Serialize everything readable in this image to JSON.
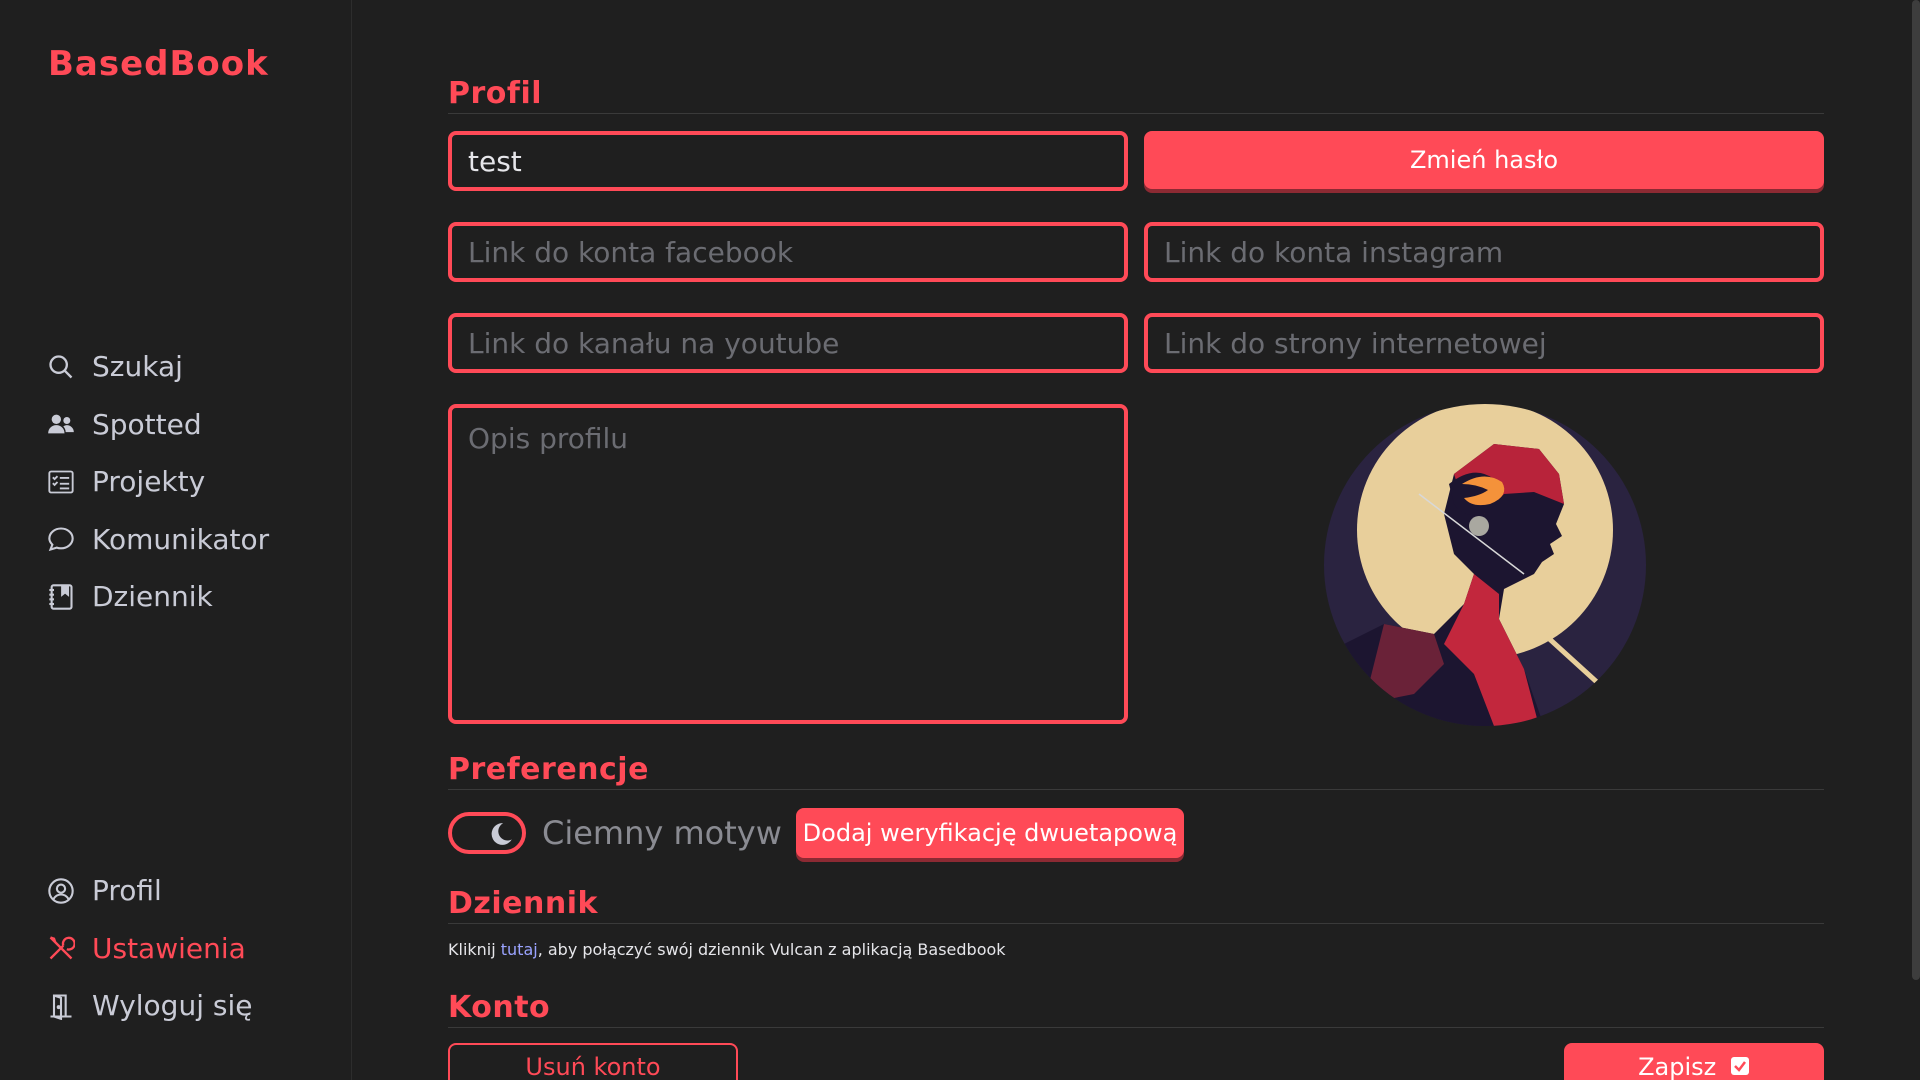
{
  "app": {
    "logo": "BasedBook"
  },
  "sidebar": {
    "top_items": [
      {
        "label": "Szukaj",
        "icon": "search-icon"
      },
      {
        "label": "Spotted",
        "icon": "users-icon"
      },
      {
        "label": "Projekty",
        "icon": "checklist-icon"
      },
      {
        "label": "Komunikator",
        "icon": "chat-bubble-icon"
      },
      {
        "label": "Dziennik",
        "icon": "notebook-icon"
      }
    ],
    "bottom_items": [
      {
        "label": "Profil",
        "icon": "user-circle-icon"
      },
      {
        "label": "Ustawienia",
        "icon": "tools-icon",
        "active": true
      },
      {
        "label": "Wyloguj się",
        "icon": "door-icon"
      }
    ]
  },
  "profile": {
    "title": "Profil",
    "username_value": "test",
    "change_password": "Zmień hasło",
    "facebook_placeholder": "Link do konta facebook",
    "instagram_placeholder": "Link do konta instagram",
    "youtube_placeholder": "Link do kanału na youtube",
    "website_placeholder": "Link do strony internetowej",
    "description_placeholder": "Opis profilu"
  },
  "preferences": {
    "title": "Preferencje",
    "dark_theme_label": "Ciemny motyw",
    "two_factor_button": "Dodaj weryfikację dwuetapową"
  },
  "journal": {
    "title": "Dziennik",
    "text_before": "Kliknij ",
    "link": "tutaj",
    "text_after": ", aby połączyć swój dziennik Vulcan z aplikacją Basedbook"
  },
  "account": {
    "title": "Konto",
    "delete_button": "Usuń konto",
    "save_button": "Zapisz"
  },
  "colors": {
    "accent": "#ff4a57",
    "background": "#1f1f1f",
    "text": "#c9cbd6"
  }
}
